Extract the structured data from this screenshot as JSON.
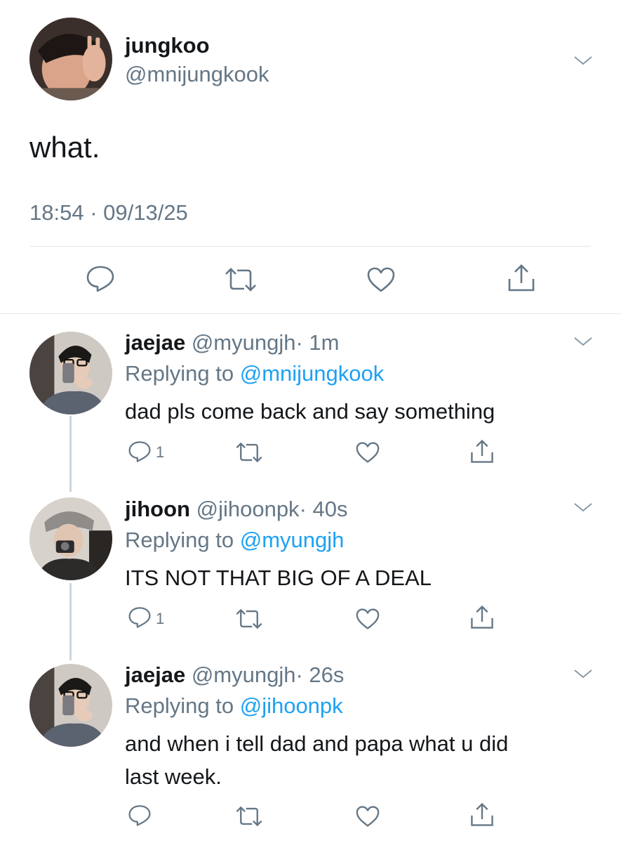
{
  "main_tweet": {
    "display_name": "jungkoo",
    "handle": "@mnijungkook",
    "text": "what.",
    "timestamp": "18:54 · 09/13/25"
  },
  "replies": [
    {
      "display_name": "jaejae",
      "handle": "@myungjh",
      "time": "· 1m",
      "replying_prefix": "Replying to",
      "replying_to": "@mnijungkook",
      "text": "dad pls come back and say something",
      "reply_count": "1"
    },
    {
      "display_name": "jihoon",
      "handle": "@jihoonpk",
      "time": "· 40s",
      "replying_prefix": "Replying to",
      "replying_to": "@myungjh",
      "text": "ITS NOT THAT BIG OF A DEAL",
      "reply_count": "1"
    },
    {
      "display_name": "jaejae",
      "handle": "@myungjh",
      "time": "· 26s",
      "replying_prefix": "Replying to",
      "replying_to": "@jihoonpk",
      "text_line1": "and when i tell dad and papa what u did",
      "text_line2": "last week."
    }
  ],
  "colors": {
    "link": "#1da1f2",
    "muted": "#657786",
    "divider": "#e1e8ed",
    "thread_line": "#ccd6dd"
  },
  "icons": [
    "reply-icon",
    "retweet-icon",
    "like-icon",
    "share-icon",
    "chevron-down-icon"
  ]
}
